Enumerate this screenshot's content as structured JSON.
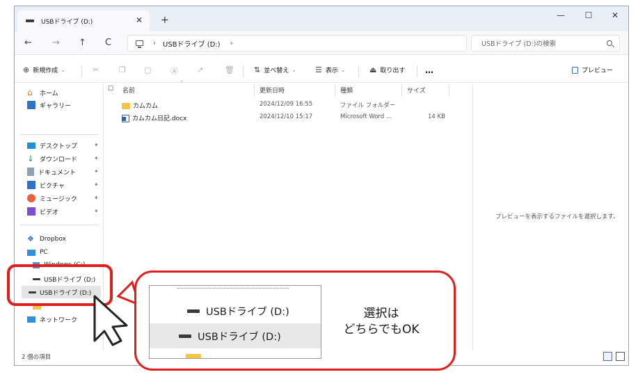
{
  "titlebar": {
    "tab_title": "USBドライブ (D:)",
    "tab_close": "✕",
    "new_tab": "+",
    "minimize": "—",
    "maximize": "☐",
    "close": "✕"
  },
  "address": {
    "separator": "›",
    "crumb": "USBドライブ (D:)",
    "search_placeholder": "USBドライブ (D:)の検索"
  },
  "nav": {
    "back": "←",
    "forward": "→",
    "up": "↑",
    "refresh": "C"
  },
  "commandbar": {
    "new": "新規作成",
    "sort": "並べ替え",
    "view": "表示",
    "eject": "取り出す",
    "more": "…",
    "preview": "プレビュー"
  },
  "sidebar": {
    "home": "ホーム",
    "gallery": "ギャラリー",
    "desktop": "デスクトップ",
    "downloads": "ダウンロード",
    "documents": "ドキュメント",
    "pictures": "ピクチャ",
    "music": "ミュージック",
    "videos": "ビデオ",
    "dropbox": "Dropbox",
    "pc": "PC",
    "windows_c": "Windows (C:)",
    "usb_nested": "USBドライブ (D:)",
    "usb_selected": "USBドライブ (D:)",
    "network": "ネットワーク"
  },
  "columns": {
    "name": "名前",
    "modified": "更新日時",
    "type": "種類",
    "size": "サイズ"
  },
  "files": [
    {
      "name": "カムカム",
      "modified": "2024/12/09 16:55",
      "type": "ファイル フォルダー",
      "size": ""
    },
    {
      "name": "カムカム日記.docx",
      "modified": "2024/12/10 15:17",
      "type": "Microsoft Word ...",
      "size": "14 KB"
    }
  ],
  "preview_message": "プレビューを表示するファイルを選択します。",
  "status": "2 個の項目",
  "callout": {
    "zoom_item_1": "USBドライブ (D:)",
    "zoom_item_2": "USBドライブ (D:)",
    "text_line1": "選択は",
    "text_line2": "どちらでもOK"
  },
  "colors": {
    "highlight": "#e01e1e",
    "folder": "#f3c343",
    "word": "#2b5ead"
  }
}
